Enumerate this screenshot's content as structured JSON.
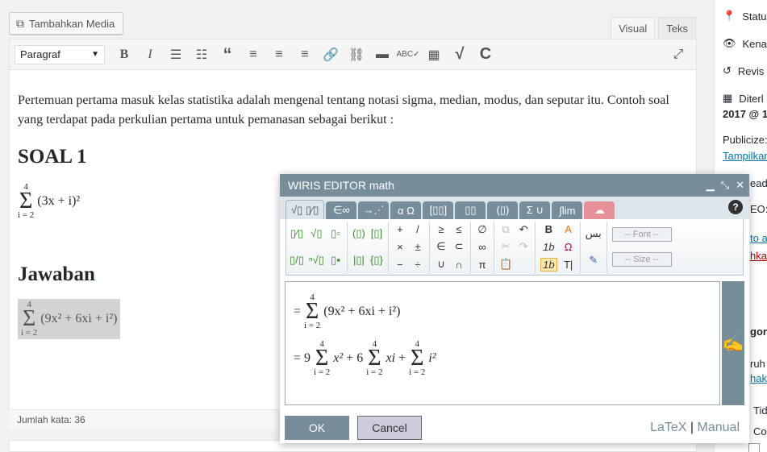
{
  "editor": {
    "add_media": "Tambahkan Media",
    "tabs": [
      "Visual",
      "Teks"
    ],
    "format_select": "Paragraf",
    "paragraph": "Pertemuan pertama masuk kelas statistika adalah mengenal tentang notasi sigma, median, modus, dan seputar itu. Contoh soal yang terdapat pada perkulian pertama untuk pemanasan sebagai berikut :",
    "heading1": "SOAL 1",
    "formula1": {
      "upper": "4",
      "lower": "i = 2",
      "body": "(3x + i)²"
    },
    "heading2": "Jawaban",
    "formula2": {
      "upper": "4",
      "lower": "i = 2",
      "body": "(9x² + 6xi + i²)"
    },
    "word_count": "Jumlah kata: 36"
  },
  "sidebar": {
    "status": "Status",
    "visibility": "Kena",
    "revisions": "Revis",
    "published_label": "Diterl",
    "published_date": "2017 @ 1",
    "publicize": "Publicize:",
    "publicize_link": "Tampilkan",
    "readability": "eada",
    "seo": "EO:",
    "link1": "to a",
    "link2": "hka",
    "category": "gor",
    "cat1": "ruh",
    "cat2": "haka",
    "cat3": "Tid",
    "cat4": "Co"
  },
  "wiris": {
    "title": "WIRIS EDITOR math",
    "tabs": [
      "√▯ ▯⁄▯",
      "∈∞",
      "→⋰",
      "α Ω",
      "[▯▯]",
      "▯▯",
      "(▯)",
      "Σ ∪",
      "∫lim",
      "☁"
    ],
    "font_select": "-- Font --",
    "size_select": "-- Size --",
    "eq1": {
      "upper": "4",
      "lower": "i = 2",
      "body": "(9x² + 6xi + i²)"
    },
    "eq2": {
      "c1": "9",
      "b1": "x²",
      "c2": "+ 6",
      "b2": "xi",
      "c3": "+",
      "b3": "i²",
      "upper": "4",
      "lower": "i = 2"
    },
    "ok": "OK",
    "cancel": "Cancel",
    "latex": "LaTeX",
    "manual": "Manual"
  }
}
